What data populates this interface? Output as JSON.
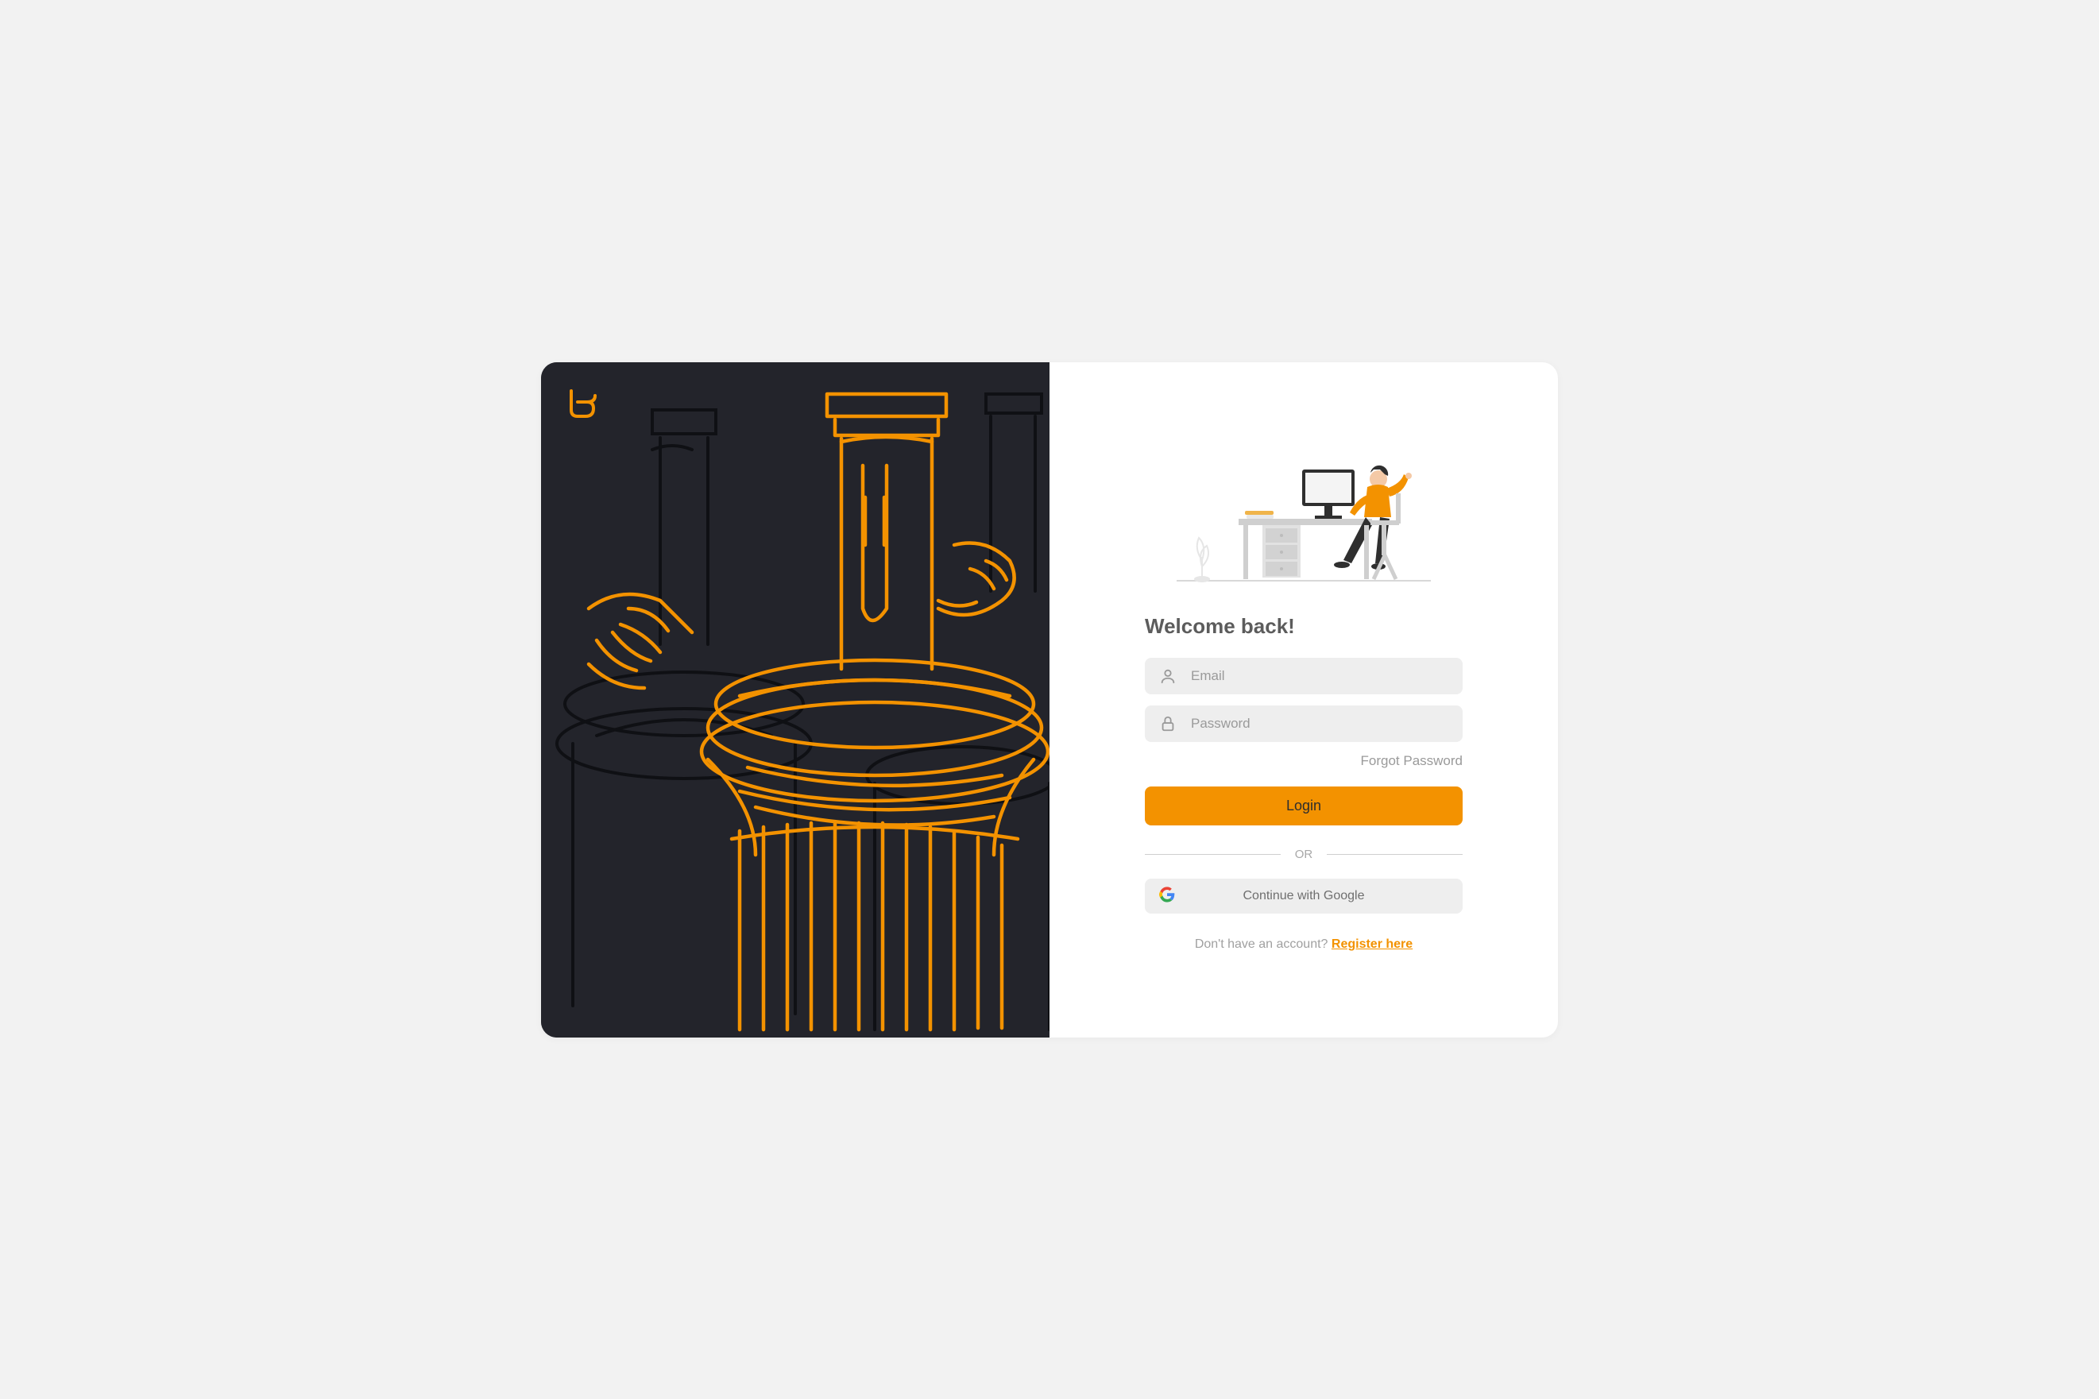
{
  "title": "Welcome back!",
  "email": {
    "placeholder": "Email",
    "value": ""
  },
  "password": {
    "placeholder": "Password",
    "value": ""
  },
  "forgot": "Forgot Password",
  "login": "Login",
  "or": "OR",
  "google": "Continue with Google",
  "signup_prompt": "Don't have an account? ",
  "signup_link": "Register here",
  "colors": {
    "accent": "#f39200",
    "dark": "#23242b",
    "field_bg": "#eeeeee"
  }
}
